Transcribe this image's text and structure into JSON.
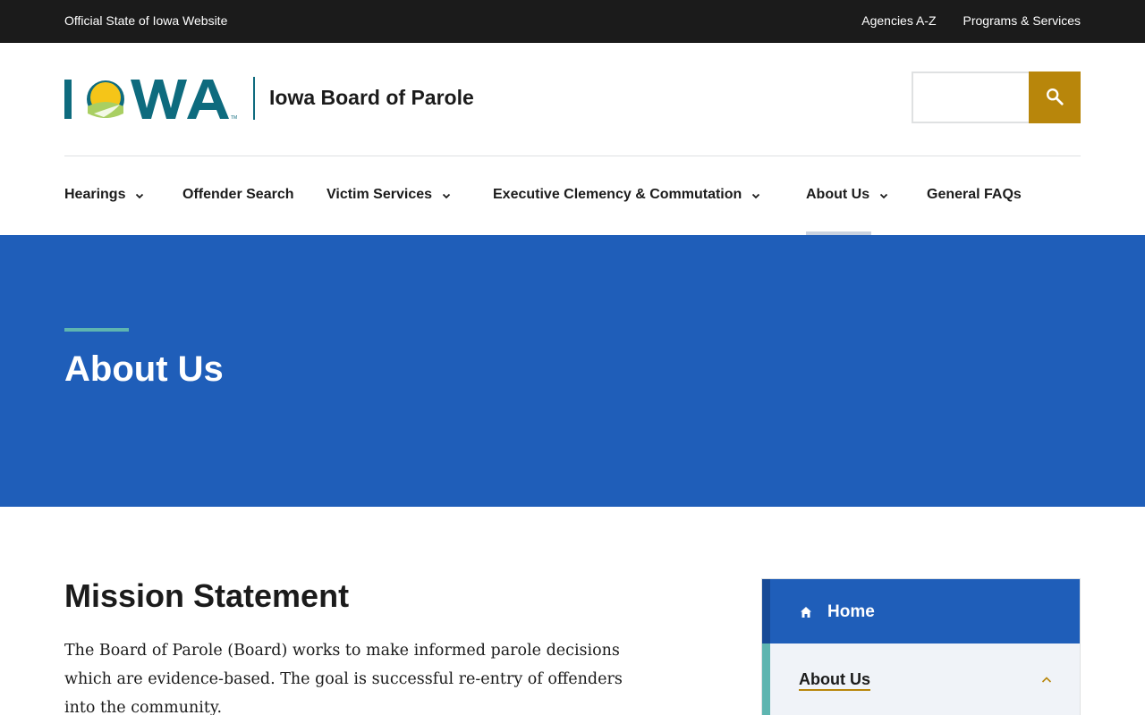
{
  "utility_bar": {
    "official_text": "Official State of Iowa Website",
    "links": [
      "Agencies A-Z",
      "Programs & Services"
    ]
  },
  "header": {
    "logo_text": "IOWA",
    "site_name": "Iowa Board of Parole",
    "search_placeholder": "",
    "search_icon": "search-icon"
  },
  "nav": {
    "items": [
      {
        "label": "Hearings",
        "has_dropdown": true
      },
      {
        "label": "Offender Search",
        "has_dropdown": false
      },
      {
        "label": "Victim Services",
        "has_dropdown": true
      },
      {
        "label": "Executive Clemency & Commutation",
        "has_dropdown": true
      },
      {
        "label": "About Us",
        "has_dropdown": true,
        "active": true
      },
      {
        "label": "General FAQs",
        "has_dropdown": false
      }
    ]
  },
  "hero": {
    "title": "About Us"
  },
  "content": {
    "heading": "Mission Statement",
    "body": "The Board of Parole (Board) works to make informed parole decisions which are evidence-based. The goal is successful re-entry of offenders into the community."
  },
  "side_nav": {
    "home_label": "Home",
    "current_label": "About Us"
  },
  "colors": {
    "utility_bg": "#1b1b1b",
    "hero_bg": "#1f5eb9",
    "accent_gold": "#b8860b",
    "accent_teal": "#5eb5b0",
    "logo_teal": "#0e6b7e"
  }
}
